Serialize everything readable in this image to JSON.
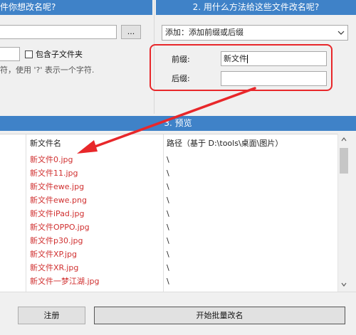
{
  "section1": {
    "title": "件你想改名呢?"
  },
  "section2": {
    "title": "2. 用什么方法给这些文件改名呢?",
    "method_select": "添加：添加前缀或后缀",
    "prefix_label": "前缀:",
    "prefix_value": "新文件",
    "suffix_label": "后缀:",
    "suffix_value": ""
  },
  "folder": {
    "browse_label": "...",
    "include_subfolders_label": "包含子文件夹",
    "hint_text": "符，使用 '?' 表示一个字符."
  },
  "preview": {
    "title": "3. 预览",
    "col_new_name": "新文件名",
    "col_path": "路径（基于 D:\\tools\\桌面\\图片）",
    "rows": [
      {
        "name": "新文件0.jpg",
        "path": "\\"
      },
      {
        "name": "新文件11.jpg",
        "path": "\\"
      },
      {
        "name": "新文件ewe.jpg",
        "path": "\\"
      },
      {
        "name": "新文件ewe.png",
        "path": "\\"
      },
      {
        "name": "新文件iPad.jpg",
        "path": "\\"
      },
      {
        "name": "新文件OPPO.jpg",
        "path": "\\"
      },
      {
        "name": "新文件p30.jpg",
        "path": "\\"
      },
      {
        "name": "新文件XP.jpg",
        "path": "\\"
      },
      {
        "name": "新文件XR.jpg",
        "path": "\\"
      },
      {
        "name": "新文件一梦江湖.jpg",
        "path": "\\"
      }
    ]
  },
  "footer": {
    "register_label": "注册",
    "start_label": "开始批量改名"
  },
  "colors": {
    "header_bg": "#3f82c8",
    "highlight": "#e8272a",
    "name_text": "#d03030"
  },
  "icons": {
    "dropdown": "chevron-down-icon",
    "arrow": "red-arrow-annotation"
  }
}
